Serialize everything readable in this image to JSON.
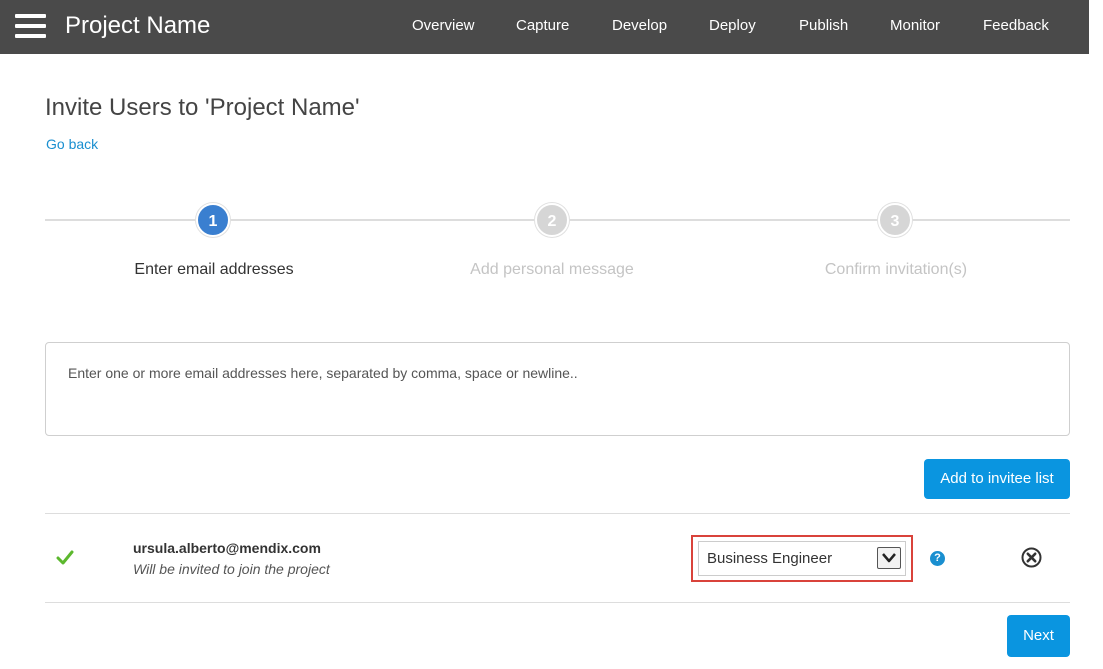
{
  "header": {
    "project_name": "Project Name",
    "nav": [
      "Overview",
      "Capture",
      "Develop",
      "Deploy",
      "Publish",
      "Monitor",
      "Feedback"
    ]
  },
  "page": {
    "title": "Invite Users to 'Project Name'",
    "go_back": "Go back"
  },
  "stepper": {
    "current_step": 1,
    "steps": [
      {
        "number": "1",
        "label": "Enter email addresses"
      },
      {
        "number": "2",
        "label": "Add personal message"
      },
      {
        "number": "3",
        "label": "Confirm invitation(s)"
      }
    ]
  },
  "email_input": {
    "placeholder": "Enter one or more email addresses here, separated by comma, space or newline.."
  },
  "buttons": {
    "add_to_invitee_list": "Add to invitee list",
    "next": "Next"
  },
  "invitees": [
    {
      "email": "ursula.alberto@mendix.com",
      "note": "Will be invited to join the project",
      "role": "Business Engineer"
    }
  ],
  "icons": {
    "menu": "hamburger-icon",
    "valid": "checkmark-icon",
    "help": "question-icon",
    "remove": "close-circle-icon",
    "dropdown": "chevron-down-icon"
  },
  "colors": {
    "topbar": "#4a4a4a",
    "accent": "#0a95e0",
    "link": "#1a8fd0",
    "step_active": "#3a7fd0",
    "step_inactive": "#d6d6d6",
    "check": "#5cb82e",
    "highlight": "#d9433b"
  }
}
